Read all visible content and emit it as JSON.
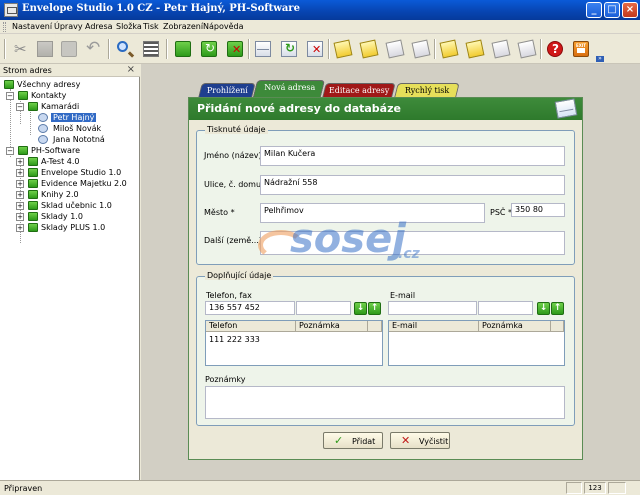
{
  "window": {
    "title": "Envelope Studio 1.0 CZ - Petr Hajný, PH-Software"
  },
  "menu": [
    "Nastavení",
    "Úpravy",
    "Adresa",
    "Složka",
    "Tisk",
    "Zobrazení",
    "Nápověda"
  ],
  "sidebar": {
    "title": "Strom adres",
    "close": "×",
    "tree": {
      "root": "Všechny adresy",
      "kontakty": "Kontakty",
      "kamaradi": "Kamarádi",
      "people": [
        "Petr Hajný",
        "Miloš Novák",
        "Jana Nototná"
      ],
      "ph": "PH-Software",
      "ph_children": [
        "A-Test 4.0",
        "Envelope Studio 1.0",
        "Evidence Majetku 2.0",
        "Knihy 2.0",
        "Sklad učebnic 1.0",
        "Sklady 1.0",
        "Sklady PLUS 1.0"
      ]
    }
  },
  "tabs": [
    "Prohlížení",
    "Nová adresa",
    "Editace adresy",
    "Rychlý tisk"
  ],
  "panel": {
    "title": "Přidání nové adresy do databáze",
    "printed": {
      "legend": "Tisknuté údaje",
      "name_label": "Jméno (název) *",
      "name_value": "Milan Kučera",
      "street_label": "Ulice, č. domu",
      "street_value": "Nádražní 558",
      "city_label": "Město *",
      "city_value": "Pelhřimov",
      "psc_label": "PSČ *",
      "psc_value": "350 80",
      "other_label": "Další (země...)",
      "other_value": ""
    },
    "extra": {
      "legend": "Doplňující údaje",
      "phone_label": "Telefon, fax",
      "phone_value": "136 557 452",
      "email_label": "E-mail",
      "phone_grid_headers": [
        "Telefon",
        "Poznámka"
      ],
      "phone_grid_rows": [
        [
          "111 222 333",
          ""
        ]
      ],
      "email_grid_headers": [
        "E-mail",
        "Poznámka"
      ],
      "notes_label": "Poznámky"
    },
    "buttons": {
      "add": "Přidat",
      "clear": "Vyčistit",
      "exit_icon_text": "EXIT"
    }
  },
  "watermark": {
    "text": "sosej",
    "tld": ".cz"
  },
  "status": {
    "text": "Připraven",
    "num": "123"
  },
  "colors": {
    "titlebar": "#0744b0",
    "panel_header": "#3e8b3b",
    "tab_prohlizeni": "#1f3f8f",
    "tab_nova": "#3d8a3a",
    "tab_editace": "#a01818",
    "tab_tisk": "#e6df5a"
  }
}
